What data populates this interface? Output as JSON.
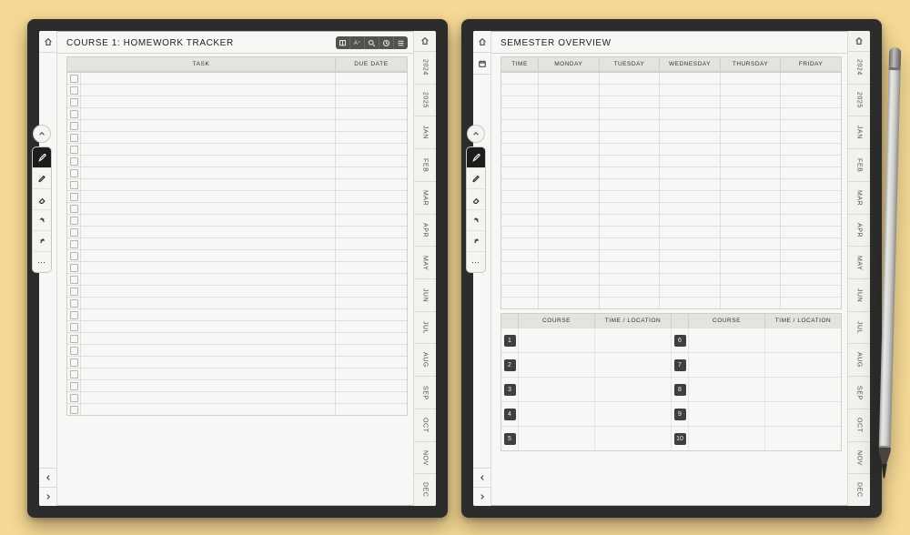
{
  "left_page": {
    "title": "COURSE 1: HOMEWORK TRACKER",
    "toolbar_icons": [
      "book-icon",
      "text-size-icon",
      "search-icon",
      "clock-icon",
      "menu-icon"
    ],
    "columns": {
      "task": "TASK",
      "due": "DUE DATE"
    },
    "row_count": 29
  },
  "right_page": {
    "title": "SEMESTER OVERVIEW",
    "schedule": {
      "time_label": "TIME",
      "days": [
        "MONDAY",
        "TUESDAY",
        "WEDNESDAY",
        "THURSDAY",
        "FRIDAY"
      ],
      "row_count": 20
    },
    "courses": {
      "headers": [
        "COURSE",
        "TIME / LOCATION",
        "COURSE",
        "TIME / LOCATION"
      ],
      "left_numbers": [
        "1",
        "2",
        "3",
        "4",
        "5"
      ],
      "right_numbers": [
        "6",
        "7",
        "8",
        "9",
        "10"
      ]
    }
  },
  "side_tabs": [
    "2024",
    "2025",
    "JAN",
    "FEB",
    "MAR",
    "APR",
    "MAY",
    "JUN",
    "JUL",
    "AUG",
    "SEP",
    "OCT",
    "NOV",
    "DEC"
  ],
  "float_tools": [
    "pen",
    "highlighter",
    "eraser",
    "undo",
    "redo",
    "more"
  ]
}
